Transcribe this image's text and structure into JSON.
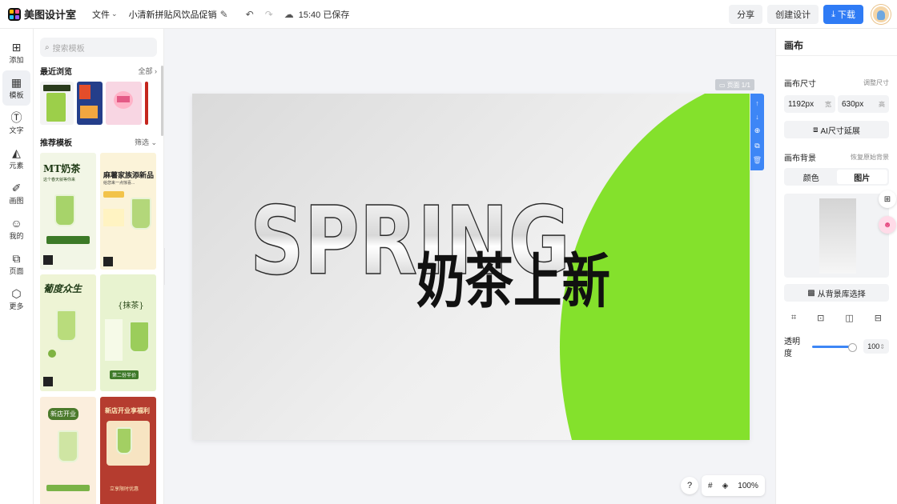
{
  "app": {
    "name": "美图设计室"
  },
  "toolbar": {
    "file_menu": "文件",
    "doc_title": "小清新拼贴风饮品促销上新...",
    "save_status": "15:40 已保存",
    "share": "分享",
    "create_design": "创建设计",
    "download": "下载"
  },
  "rail": {
    "items": [
      {
        "label": "添加",
        "icon": "plus-square-icon"
      },
      {
        "label": "模板",
        "icon": "template-icon",
        "active": true
      },
      {
        "label": "文字",
        "icon": "text-icon"
      },
      {
        "label": "元素",
        "icon": "shapes-icon"
      },
      {
        "label": "画图",
        "icon": "brush-icon"
      },
      {
        "label": "我的",
        "icon": "user-icon"
      },
      {
        "label": "页面",
        "icon": "page-icon"
      },
      {
        "label": "更多",
        "icon": "cube-icon"
      }
    ]
  },
  "panel": {
    "search_placeholder": "搜索模板",
    "recent_title": "最近浏览",
    "recent_all": "全部",
    "recommend_title": "推荐模板",
    "filter": "筛选",
    "templates": [
      {
        "title": "MT奶茶",
        "subtitle": "这个春天就等你来"
      },
      {
        "title": "麻薯家族添新品",
        "subtitle": "给您来一点惊喜..."
      },
      {
        "title": "葡度众生",
        "subtitle": ""
      },
      {
        "title": "{抹茶}",
        "subtitle": "第二份半价"
      },
      {
        "title": "新店开业",
        "subtitle": ""
      },
      {
        "title": "新店开业享福利",
        "subtitle": "立享限时优惠"
      }
    ]
  },
  "canvas": {
    "page_badge": "页面 1/1",
    "headline_en": "SPRING",
    "headline_zh": "奶茶上新",
    "accent": "#84e12c",
    "zoom": "100%",
    "help": "?"
  },
  "props": {
    "title": "画布",
    "size_label": "画布尺寸",
    "resize": "调整尺寸",
    "width_value": "1192px",
    "width_unit": "宽",
    "height_value": "630px",
    "height_unit": "高",
    "ai_extend": "AI尺寸延展",
    "bg_label": "画布背景",
    "bg_reset": "恢复原始背景",
    "tab_color": "颜色",
    "tab_image": "图片",
    "bg_library": "从背景库选择",
    "opacity_label": "透明度",
    "opacity_value": "100"
  }
}
